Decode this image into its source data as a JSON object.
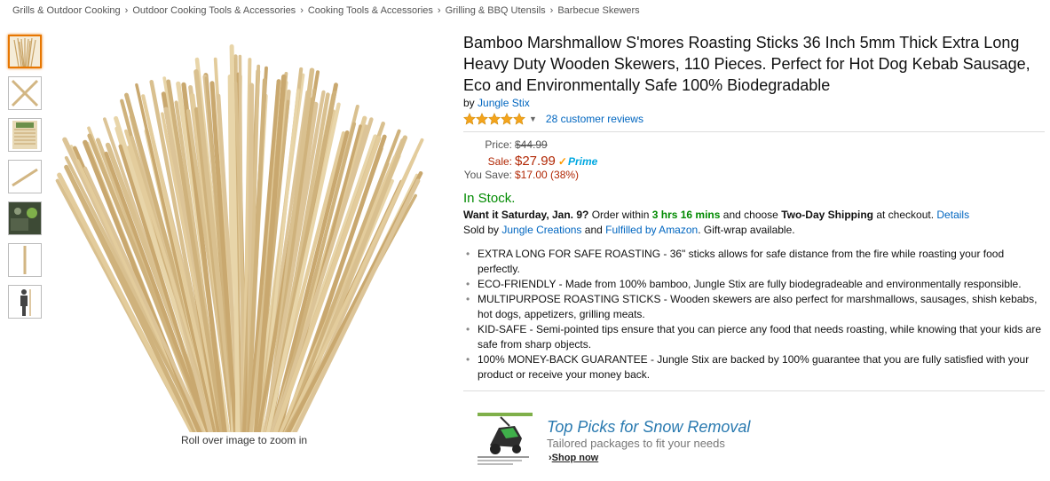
{
  "breadcrumb": [
    "Grills & Outdoor Cooking",
    "Outdoor Cooking Tools & Accessories",
    "Cooking Tools & Accessories",
    "Grilling & BBQ Utensils",
    "Barbecue Skewers"
  ],
  "breadcrumb_sep": "›",
  "image": {
    "zoom_hint": "Roll over image to zoom in"
  },
  "product": {
    "title": "Bamboo Marshmallow S'mores Roasting Sticks 36 Inch 5mm Thick Extra Long Heavy Duty Wooden Skewers, 110 Pieces. Perfect for Hot Dog Kebab Sausage, Eco and Environmentally Safe 100% Biodegradable",
    "by": "by",
    "brand": "Jungle Stix",
    "rating": 5,
    "review_count": "28 customer reviews"
  },
  "price": {
    "list_label": "Price:",
    "list_price": "$44.99",
    "sale_label": "Sale:",
    "sale_price": "$27.99",
    "prime": "Prime",
    "save_label": "You Save:",
    "save_value": "$17.00 (38%)"
  },
  "availability": {
    "stock": "In Stock.",
    "want_it": "Want it Saturday, Jan. 9?",
    "order_within": "Order within",
    "time": "3 hrs 16 mins",
    "and_choose": "and choose",
    "shipping": "Two-Day Shipping",
    "at_checkout": "at checkout.",
    "details": "Details",
    "sold_by": "Sold by",
    "seller": "Jungle Creations",
    "and": "and",
    "fulfilled": "Fulfilled by Amazon",
    "gift": ". Gift-wrap available."
  },
  "bullets": [
    "EXTRA LONG FOR SAFE ROASTING - 36\" sticks allows for safe distance from the fire while roasting your food perfectly.",
    "ECO-FRIENDLY - Made from 100% bamboo, Jungle Stix are fully biodegradeable and environmentally responsible.",
    "MULTIPURPOSE ROASTING STICKS - Wooden skewers are also perfect for marshmallows, sausages, shish kebabs, hot dogs, appetizers, grilling meats.",
    "KID-SAFE - Semi-pointed tips ensure that you can pierce any food that needs roasting, while knowing that your kids are safe from sharp objects.",
    "100% MONEY-BACK GUARANTEE - Jungle Stix are backed by 100% guarantee that you are fully satisfied with your product or receive your money back."
  ],
  "ad": {
    "title": "Top Picks for Snow Removal",
    "subtitle": "Tailored packages to fit your needs",
    "cta": "Shop now"
  },
  "colors": {
    "link": "#0066c0",
    "price": "#b12704",
    "stock": "#008a00",
    "star": "#f4a41c",
    "prime": "#00a8e1"
  }
}
